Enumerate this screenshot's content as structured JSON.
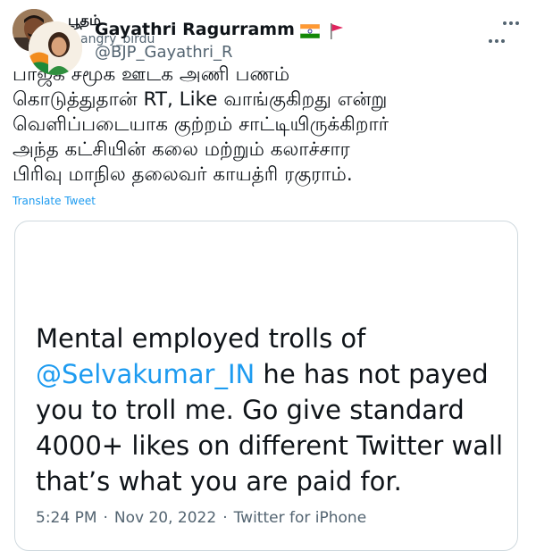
{
  "author": {
    "name": "பூதம்",
    "handle": "@angry_birdu"
  },
  "tweet": {
    "lines": [
      "பாஜக சமூக ஊடக அணி பணம்",
      "கொடுத்துதான் RT, Like வாங்குகிறது என்று",
      "வெளிப்படையாக குற்றம் சாட்டியிருக்கிறார்",
      "அந்த கட்சியின் கலை மற்றும் கலாச்சார",
      "பிரிவு மாநில தலைவர் காயத்ரி ரகுராம்."
    ],
    "translate_label": "Translate Tweet"
  },
  "quoted": {
    "name": "Gayathri Ragurramm",
    "handle": "@BJP_Gayathri_R",
    "line1": "Mental employed trolls of",
    "mention": "@Selvakumar_IN",
    "line2_rest": " he has not payed",
    "line3": "you to troll me. Go give standard",
    "line4": "4000+ likes on different Twitter wall",
    "line5": "that’s what you are paid for.",
    "time": "5:24 PM",
    "date": "Nov 20, 2022",
    "source": "Twitter for iPhone",
    "separator": "·"
  },
  "icons": {
    "more": "more-dots-icon",
    "india_flag": "india-flag-icon",
    "red_flag": "red-flag-icon"
  },
  "colors": {
    "link": "#1d9bf0",
    "secondary": "#536471",
    "border": "#cfd9de"
  }
}
